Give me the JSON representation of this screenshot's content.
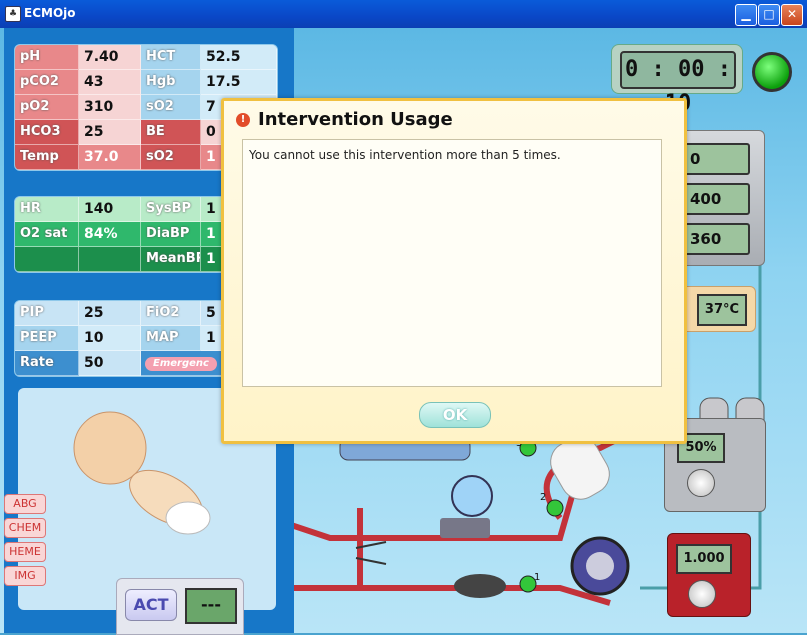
{
  "window": {
    "title": "ECMOjo",
    "controls": [
      "minimize",
      "maximize",
      "close"
    ]
  },
  "labs": {
    "rows": [
      {
        "l1": "pH",
        "v1": "7.40",
        "l2": "HCT",
        "v2": "52.5"
      },
      {
        "l1": "pCO2",
        "v1": "43",
        "l2": "Hgb",
        "v2": "17.5"
      },
      {
        "l1": "pO2",
        "v1": "310",
        "l2": "sO2",
        "v2": "7"
      },
      {
        "l1": "HCO3",
        "v1": "25",
        "l2": "BE",
        "v2": "0"
      },
      {
        "l1": "Temp",
        "v1": "37.0",
        "l2": "sO2",
        "v2": "1"
      }
    ]
  },
  "vitals": {
    "rows": [
      {
        "l1": "HR",
        "v1": "140",
        "l2": "SysBP",
        "v2": "1"
      },
      {
        "l1": "O2 sat",
        "v1": "84%",
        "l2": "DiaBP",
        "v2": "1"
      },
      {
        "l1": "",
        "v1": "",
        "l2": "MeanBP",
        "v2": "1"
      }
    ]
  },
  "vent": {
    "rows": [
      {
        "l1": "PIP",
        "v1": "25",
        "l2": "FiO2",
        "v2": "5"
      },
      {
        "l1": "PEEP",
        "v1": "10",
        "l2": "MAP",
        "v2": "1"
      },
      {
        "l1": "Rate",
        "v1": "50",
        "l2": "Emergenc",
        "v2": ""
      }
    ]
  },
  "side_buttons": [
    "ABG",
    "CHEM",
    "HEME",
    "IMG"
  ],
  "act": {
    "label": "ACT",
    "value": "---"
  },
  "timer": "0 : 00 : 10",
  "pump_displays": [
    "0",
    "400",
    "360"
  ],
  "heater_temp": "37°C",
  "gas_percent": "50%",
  "flow_value": "1.000",
  "circuit_labels": [
    "3",
    "2",
    "1"
  ],
  "dialog": {
    "title": "Intervention Usage",
    "message": "You cannot use this intervention more than 5 times.",
    "ok": "OK"
  },
  "colors": {
    "titlebar": "#0a47c7",
    "dialog_border": "#f0c040",
    "panel": "#1777c8"
  }
}
